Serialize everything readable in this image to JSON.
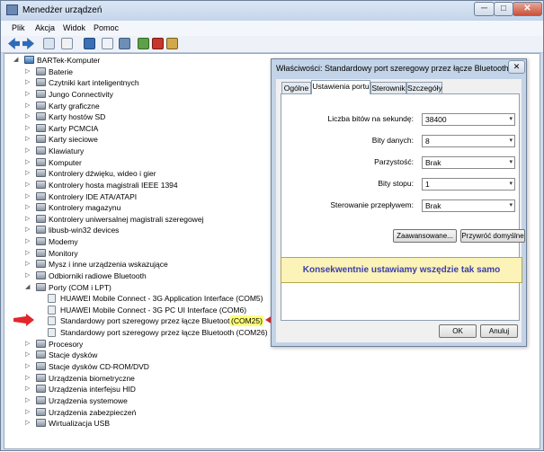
{
  "window": {
    "title": "Menedżer urządzeń"
  },
  "menu": [
    "Plik",
    "Akcja",
    "Widok",
    "Pomoc"
  ],
  "tree": {
    "root": "BARTek-Komputer",
    "categories": [
      "Baterie",
      "Czytniki kart inteligentnych",
      "Jungo Connectivity",
      "Karty graficzne",
      "Karty hostów SD",
      "Karty PCMCIA",
      "Karty sieciowe",
      "Klawiatury",
      "Komputer",
      "Kontrolery dźwięku, wideo i gier",
      "Kontrolery hosta magistrali IEEE 1394",
      "Kontrolery IDE ATA/ATAPI",
      "Kontrolery magazynu",
      "Kontrolery uniwersalnej magistrali szeregowej",
      "libusb-win32 devices",
      "Modemy",
      "Monitory",
      "Mysz i inne urządzenia wskazujące",
      "Odbiorniki radiowe Bluetooth",
      "Porty (COM i LPT)"
    ],
    "ports": [
      "HUAWEI Mobile Connect - 3G Application Interface (COM5)",
      "HUAWEI Mobile Connect - 3G PC UI Interface (COM6)",
      "Standardowy port szeregowy przez łącze Bluetooth",
      "Standardowy port szeregowy przez łącze Bluetooth (COM26)"
    ],
    "selected_port_suffix": "(COM25)",
    "categories_after": [
      "Procesory",
      "Stacje dysków",
      "Stacje dysków CD-ROM/DVD",
      "Urządzenia biometryczne",
      "Urządzenia interfejsu HID",
      "Urządzenia systemowe",
      "Urządzenia zabezpieczeń",
      "Wirtualizacja USB"
    ]
  },
  "dialog": {
    "title": "Właściwości: Standardowy port szeregowy przez łącze Bluetooth (...",
    "close": "✕",
    "tabs": [
      "Ogólne",
      "Ustawienia portu",
      "Sterownik",
      "Szczegóły"
    ],
    "fields": [
      {
        "label": "Liczba bitów na sekundę:",
        "value": "38400"
      },
      {
        "label": "Bity danych:",
        "value": "8"
      },
      {
        "label": "Parzystość:",
        "value": "Brak"
      },
      {
        "label": "Bity stopu:",
        "value": "1"
      },
      {
        "label": "Sterowanie przepływem:",
        "value": "Brak"
      }
    ],
    "advanced_button": "Zaawansowane...",
    "defaults_button": "Przywróć domyślne",
    "ok_button": "OK",
    "cancel_button": "Anuluj"
  },
  "callout": "Konsekwentnie ustawiamy wszędzie tak samo",
  "colors": {
    "annotation_arrow": "#e2262b",
    "callout_text": "#3b3ea8",
    "highlight": "#ffff7a"
  },
  "icons": {
    "expander": "▷",
    "expanded": "◢",
    "dropdown": "▾",
    "minimize": "─",
    "maximize": "□",
    "close": "✕"
  }
}
